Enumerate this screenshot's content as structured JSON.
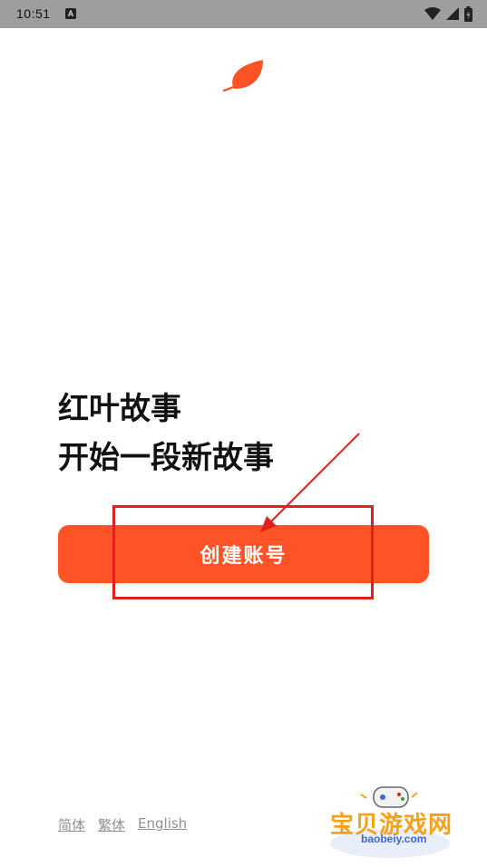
{
  "status_bar": {
    "time": "10:51",
    "notification_icon": "a-notification-icon",
    "icons": [
      "wifi-icon",
      "cellular-signal-icon",
      "battery-icon"
    ]
  },
  "logo": {
    "icon": "leaf-icon",
    "color": "#fd5326"
  },
  "headline": {
    "line1": "红叶故事",
    "line2": "开始一段新故事"
  },
  "create_account_button": {
    "label": "创建账号",
    "color": "#fd5326"
  },
  "language_options": [
    "简体",
    "繁体",
    "English"
  ],
  "watermark": {
    "text": "宝贝游戏网",
    "url": "baobeiy.com"
  },
  "annotation": {
    "color": "#e0201f"
  }
}
